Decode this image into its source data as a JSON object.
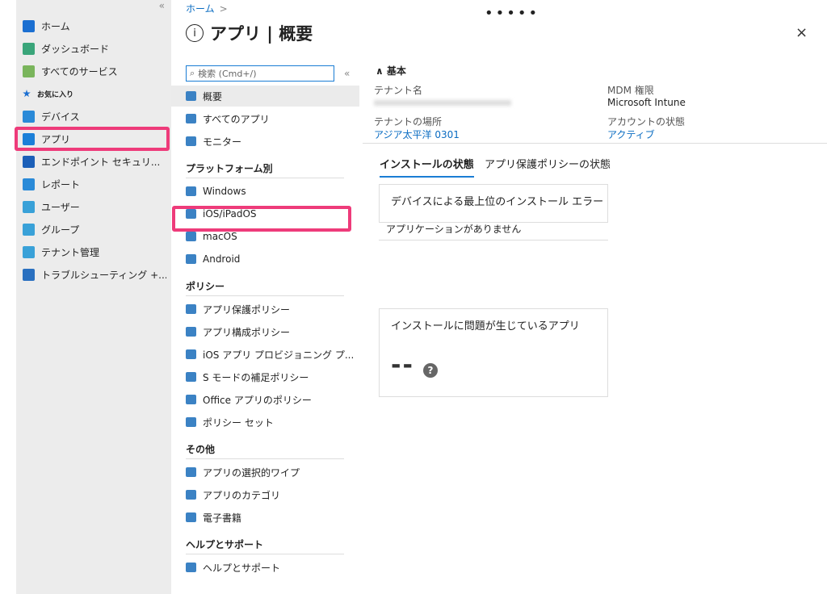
{
  "nav": {
    "collapse": "«",
    "items": [
      {
        "label": "ホーム",
        "icon": "home-icon",
        "color": "#1b6fd1"
      },
      {
        "label": "ダッシュボード",
        "icon": "dashboard-icon",
        "color": "#3aa57a"
      },
      {
        "label": "すべてのサービス",
        "icon": "list-icon",
        "color": "#7ab55c"
      },
      {
        "label": "お気に入り",
        "icon": "star-icon",
        "color": "#1b6fd1"
      },
      {
        "label": "デバイス",
        "icon": "devices-icon",
        "color": "#2a8ad8"
      },
      {
        "label": "アプリ",
        "icon": "apps-grid-icon",
        "color": "#1b7fd8"
      },
      {
        "label": "エンドポイント セキュリ...",
        "icon": "shield-icon",
        "color": "#1b5fb8"
      },
      {
        "label": "レポート",
        "icon": "report-icon",
        "color": "#2a8ad8"
      },
      {
        "label": "ユーザー",
        "icon": "user-icon",
        "color": "#39a1d8"
      },
      {
        "label": "グループ",
        "icon": "group-icon",
        "color": "#39a1d8"
      },
      {
        "label": "テナント管理",
        "icon": "tenant-admin-icon",
        "color": "#39a1d8"
      },
      {
        "label": "トラブルシューティング +...",
        "icon": "tools-icon",
        "color": "#2a70c0"
      }
    ]
  },
  "header": {
    "breadcrumb": "ホーム",
    "breadcrumb_sep": ">",
    "title": "アプリ | 概要",
    "dots": "•••••",
    "close": "×"
  },
  "menu": {
    "search_placeholder": "検索 (Cmd+/)",
    "collapse": "«",
    "top": [
      {
        "label": "概要"
      },
      {
        "label": "すべてのアプリ"
      },
      {
        "label": "モニター"
      }
    ],
    "sections": [
      {
        "title": "プラットフォーム別",
        "items": [
          {
            "label": "Windows"
          },
          {
            "label": "iOS/iPadOS"
          },
          {
            "label": "macOS"
          },
          {
            "label": "Android"
          }
        ]
      },
      {
        "title": "ポリシー",
        "items": [
          {
            "label": "アプリ保護ポリシー"
          },
          {
            "label": "アプリ構成ポリシー"
          },
          {
            "label": "iOS アプリ プロビジョニング プ..."
          },
          {
            "label": "S モードの補足ポリシー"
          },
          {
            "label": "Office アプリのポリシー"
          },
          {
            "label": "ポリシー セット"
          }
        ]
      },
      {
        "title": "その他",
        "items": [
          {
            "label": "アプリの選択的ワイプ"
          },
          {
            "label": "アプリのカテゴリ"
          },
          {
            "label": "電子書籍"
          }
        ]
      },
      {
        "title": "ヘルプとサポート",
        "items": [
          {
            "label": "ヘルプとサポート"
          }
        ]
      }
    ]
  },
  "essentials": {
    "title": "基本",
    "tenant_name_label": "テナント名",
    "tenant_location_label": "テナントの場所",
    "tenant_location": "アジア太平洋 0301",
    "mdm_label": "MDM 権限",
    "mdm_value": "Microsoft Intune",
    "account_label": "アカウントの状態",
    "account_value": "アクティブ"
  },
  "tabs": [
    {
      "label": "インストールの状態",
      "active": true
    },
    {
      "label": "アプリ保護ポリシーの状態",
      "active": false
    }
  ],
  "cards": {
    "errors_title": "デバイスによる最上位のインストール エラー",
    "errors_empty": "アプリケーションがありません",
    "failing_title": "インストールに問題が生じているアプリ",
    "failing_value": "--",
    "help": "?"
  }
}
